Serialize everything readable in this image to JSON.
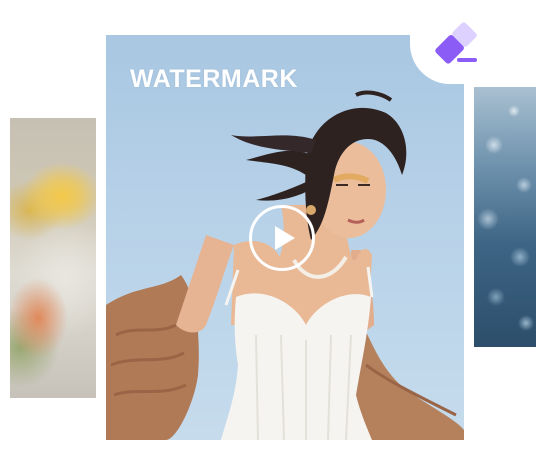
{
  "overlay": {
    "watermark_text": "WATERMARK"
  },
  "player": {
    "play_icon": "play-icon"
  },
  "tool": {
    "icon": "eraser-icon",
    "accent_color": "#8b5cf6"
  },
  "thumbnails": [
    {
      "icon": "image-thumbnail",
      "subject": "flowers"
    },
    {
      "icon": "image-thumbnail",
      "subject": "bokeh"
    }
  ]
}
